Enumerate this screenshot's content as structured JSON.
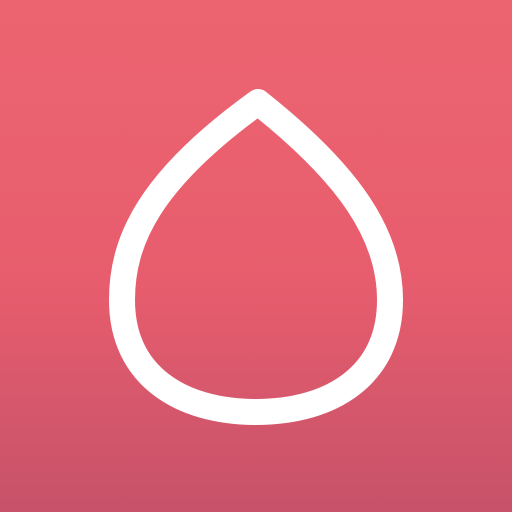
{
  "icon": {
    "name": "water-drop-icon",
    "background_top": "#ed6471",
    "background_mid": "#e75d6d",
    "background_bottom": "#c7526a",
    "stroke": "#ffffff"
  }
}
